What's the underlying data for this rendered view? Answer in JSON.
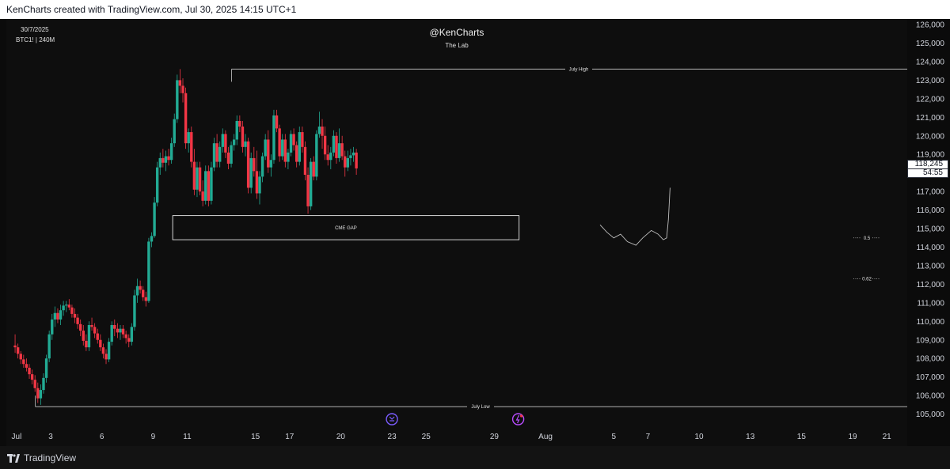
{
  "header": {
    "text": "KenCharts created with TradingView.com, Jul 30, 2025 14:15 UTC+1"
  },
  "chart_info": {
    "date": "30/7/2025",
    "symbol": "BTC1! | 240M"
  },
  "chart_title": {
    "title": "@KenCharts",
    "subtitle": "The Lab"
  },
  "footer": {
    "brand": "TradingView"
  },
  "colors": {
    "up": "#22ab94",
    "down": "#f23645",
    "background": "#0e0e0e",
    "text": "#d1d4dc"
  },
  "price_label": {
    "price": "118,245",
    "countdown": "54:55"
  },
  "chart_data": {
    "type": "candlestick",
    "y_ticks": [
      105000,
      106000,
      107000,
      108000,
      109000,
      110000,
      111000,
      112000,
      113000,
      114000,
      115000,
      116000,
      117000,
      118000,
      119000,
      120000,
      121000,
      122000,
      123000,
      124000,
      125000,
      126000
    ],
    "y_tick_labels": [
      "105,000",
      "106,000",
      "107,000",
      "108,000",
      "109,000",
      "110,000",
      "111,000",
      "112,000",
      "113,000",
      "114,000",
      "115,000",
      "116,000",
      "117,000",
      "118,000",
      "119,000",
      "120,000",
      "121,000",
      "122,000",
      "123,000",
      "124,000",
      "125,000",
      "126,000"
    ],
    "ylim": [
      104300,
      126300
    ],
    "x_labels": [
      "Jul",
      "3",
      "6",
      "9",
      "11",
      "15",
      "17",
      "20",
      "23",
      "25",
      "29",
      "Aug",
      "5",
      "7",
      "10",
      "13",
      "15",
      "19",
      "21"
    ],
    "x_label_days": [
      1,
      3,
      6,
      9,
      11,
      15,
      17,
      20,
      23,
      25,
      29,
      32,
      36,
      38,
      41,
      44,
      47,
      50,
      52
    ],
    "xlim": [
      0.4,
      53.2
    ],
    "annotations": [
      {
        "label": "July High",
        "price": 123600
      },
      {
        "label": "July Low",
        "price": 105400
      },
      {
        "label": "CME GAP",
        "price_low": 114400,
        "price_high": 115700
      },
      {
        "label": "0.5",
        "price": 114500
      },
      {
        "label": "0.62",
        "price": 112300
      }
    ],
    "projection": [
      [
        35.2,
        115.2
      ],
      [
        35.6,
        114.8
      ],
      [
        36.0,
        114.5
      ],
      [
        36.4,
        114.7
      ],
      [
        36.8,
        114.3
      ],
      [
        37.3,
        114.1
      ],
      [
        37.7,
        114.5
      ],
      [
        38.2,
        114.9
      ],
      [
        38.6,
        114.7
      ],
      [
        38.9,
        114.4
      ],
      [
        39.1,
        114.5
      ],
      [
        39.2,
        115.5
      ],
      [
        39.3,
        117.2
      ]
    ],
    "candles": [
      [
        108700,
        109300,
        108300,
        108600
      ],
      [
        108600,
        108800,
        108000,
        108250
      ],
      [
        108250,
        108400,
        107700,
        107950
      ],
      [
        107950,
        108200,
        107500,
        107700
      ],
      [
        107700,
        108000,
        107300,
        107500
      ],
      [
        107500,
        107700,
        106900,
        107150
      ],
      [
        107150,
        107400,
        106600,
        106850
      ],
      [
        106850,
        107100,
        106200,
        106400
      ],
      [
        106400,
        106700,
        105600,
        105850
      ],
      [
        105850,
        106600,
        105500,
        106300
      ],
      [
        106300,
        107200,
        106100,
        106950
      ],
      [
        106950,
        108200,
        106700,
        108000
      ],
      [
        108000,
        109500,
        107800,
        109300
      ],
      [
        109300,
        110400,
        109000,
        110100
      ],
      [
        110100,
        110800,
        109700,
        110450
      ],
      [
        110450,
        110700,
        109900,
        110100
      ],
      [
        110100,
        110900,
        109800,
        110600
      ],
      [
        110600,
        111100,
        110300,
        110850
      ],
      [
        110850,
        111100,
        110500,
        110900
      ],
      [
        110900,
        111200,
        110600,
        110750
      ],
      [
        110750,
        110900,
        110200,
        110400
      ],
      [
        110400,
        110700,
        109900,
        110200
      ],
      [
        110200,
        110400,
        109600,
        109850
      ],
      [
        109850,
        110100,
        109200,
        109500
      ],
      [
        109500,
        109800,
        108700,
        108950
      ],
      [
        108950,
        109300,
        108400,
        108600
      ],
      [
        108600,
        110000,
        108400,
        109800
      ],
      [
        109800,
        110200,
        109500,
        109700
      ],
      [
        109700,
        109900,
        109100,
        109350
      ],
      [
        109350,
        109600,
        108800,
        109000
      ],
      [
        109000,
        109300,
        108400,
        108600
      ],
      [
        108600,
        108800,
        108000,
        108250
      ],
      [
        108250,
        108500,
        107700,
        107950
      ],
      [
        107950,
        109100,
        107800,
        108900
      ],
      [
        108900,
        110000,
        108700,
        109800
      ],
      [
        109800,
        110100,
        109200,
        109600
      ],
      [
        109600,
        109900,
        109100,
        109400
      ],
      [
        109400,
        109800,
        109000,
        109600
      ],
      [
        109600,
        109800,
        109100,
        109300
      ],
      [
        109300,
        109500,
        108800,
        109100
      ],
      [
        109100,
        109300,
        108600,
        108900
      ],
      [
        108900,
        109900,
        108700,
        109700
      ],
      [
        109700,
        111700,
        109500,
        111400
      ],
      [
        111400,
        112300,
        111000,
        111900
      ],
      [
        111900,
        112200,
        111500,
        111700
      ],
      [
        111700,
        111900,
        111100,
        111300
      ],
      [
        111300,
        111600,
        110800,
        111100
      ],
      [
        111100,
        114500,
        111000,
        114300
      ],
      [
        114300,
        114800,
        114000,
        114600
      ],
      [
        114600,
        116700,
        114500,
        116400
      ],
      [
        116400,
        118600,
        116200,
        118300
      ],
      [
        118300,
        119100,
        117900,
        118800
      ],
      [
        118800,
        119300,
        118300,
        118550
      ],
      [
        118550,
        119200,
        118100,
        118900
      ],
      [
        118900,
        119300,
        118400,
        118700
      ],
      [
        118700,
        119900,
        118500,
        119600
      ],
      [
        119600,
        121200,
        119400,
        120900
      ],
      [
        120900,
        123300,
        120700,
        123000
      ],
      [
        123000,
        123600,
        122300,
        122700
      ],
      [
        122700,
        123100,
        121800,
        122300
      ],
      [
        122300,
        122600,
        119300,
        119600
      ],
      [
        119600,
        120400,
        119100,
        120200
      ],
      [
        120200,
        120500,
        118300,
        118600
      ],
      [
        118600,
        119300,
        116800,
        117100
      ],
      [
        117100,
        118600,
        116700,
        118300
      ],
      [
        118300,
        118600,
        116800,
        117000
      ],
      [
        117000,
        117600,
        116200,
        116500
      ],
      [
        116500,
        118400,
        116300,
        118100
      ],
      [
        118100,
        118400,
        116200,
        116500
      ],
      [
        116500,
        118600,
        116300,
        118300
      ],
      [
        118300,
        119900,
        118100,
        119600
      ],
      [
        119600,
        120100,
        118300,
        118600
      ],
      [
        118600,
        119700,
        118300,
        119400
      ],
      [
        119400,
        120400,
        119100,
        120100
      ],
      [
        120100,
        120300,
        118800,
        119100
      ],
      [
        119100,
        119400,
        118200,
        118500
      ],
      [
        118500,
        119700,
        118300,
        119500
      ],
      [
        119500,
        120100,
        119200,
        119800
      ],
      [
        119800,
        121100,
        119500,
        120800
      ],
      [
        120800,
        121100,
        120200,
        120500
      ],
      [
        120500,
        120800,
        119100,
        119400
      ],
      [
        119400,
        120100,
        118900,
        119700
      ],
      [
        119700,
        119900,
        116900,
        117200
      ],
      [
        117200,
        119100,
        116900,
        118800
      ],
      [
        118800,
        119400,
        117800,
        118100
      ],
      [
        118100,
        119200,
        116600,
        116900
      ],
      [
        116900,
        118100,
        116300,
        117800
      ],
      [
        117800,
        119100,
        117500,
        118900
      ],
      [
        118900,
        120100,
        118700,
        119800
      ],
      [
        119800,
        120300,
        118000,
        118300
      ],
      [
        118300,
        119000,
        117800,
        118700
      ],
      [
        118700,
        121400,
        118500,
        121100
      ],
      [
        121100,
        121400,
        120200,
        120400
      ],
      [
        120400,
        120600,
        118600,
        118900
      ],
      [
        118900,
        120100,
        118700,
        119800
      ],
      [
        119800,
        120100,
        118300,
        118600
      ],
      [
        118600,
        119300,
        118200,
        119100
      ],
      [
        119100,
        120300,
        118900,
        120100
      ],
      [
        120100,
        120400,
        119200,
        119500
      ],
      [
        119500,
        119700,
        118300,
        118600
      ],
      [
        118600,
        120500,
        118400,
        120200
      ],
      [
        120200,
        120500,
        119100,
        119400
      ],
      [
        119400,
        119700,
        117600,
        117900
      ],
      [
        117900,
        118300,
        115800,
        116200
      ],
      [
        116200,
        118800,
        116000,
        118600
      ],
      [
        118600,
        118900,
        117600,
        117800
      ],
      [
        117800,
        120300,
        117600,
        120100
      ],
      [
        120100,
        121300,
        119900,
        120500
      ],
      [
        120500,
        120900,
        119300,
        120000
      ],
      [
        120000,
        120500,
        118700,
        119000
      ],
      [
        119000,
        119500,
        118400,
        118700
      ],
      [
        118700,
        119400,
        118200,
        119100
      ],
      [
        119100,
        120300,
        118900,
        120000
      ],
      [
        120000,
        120200,
        118500,
        118800
      ],
      [
        118800,
        120400,
        118600,
        119600
      ],
      [
        119600,
        120000,
        118700,
        118900
      ],
      [
        118900,
        119200,
        117800,
        118300
      ],
      [
        118300,
        119200,
        118100,
        118800
      ],
      [
        118800,
        119300,
        118400,
        118950
      ],
      [
        118950,
        119400,
        118600,
        119100
      ],
      [
        119100,
        119300,
        117900,
        118245
      ]
    ]
  }
}
